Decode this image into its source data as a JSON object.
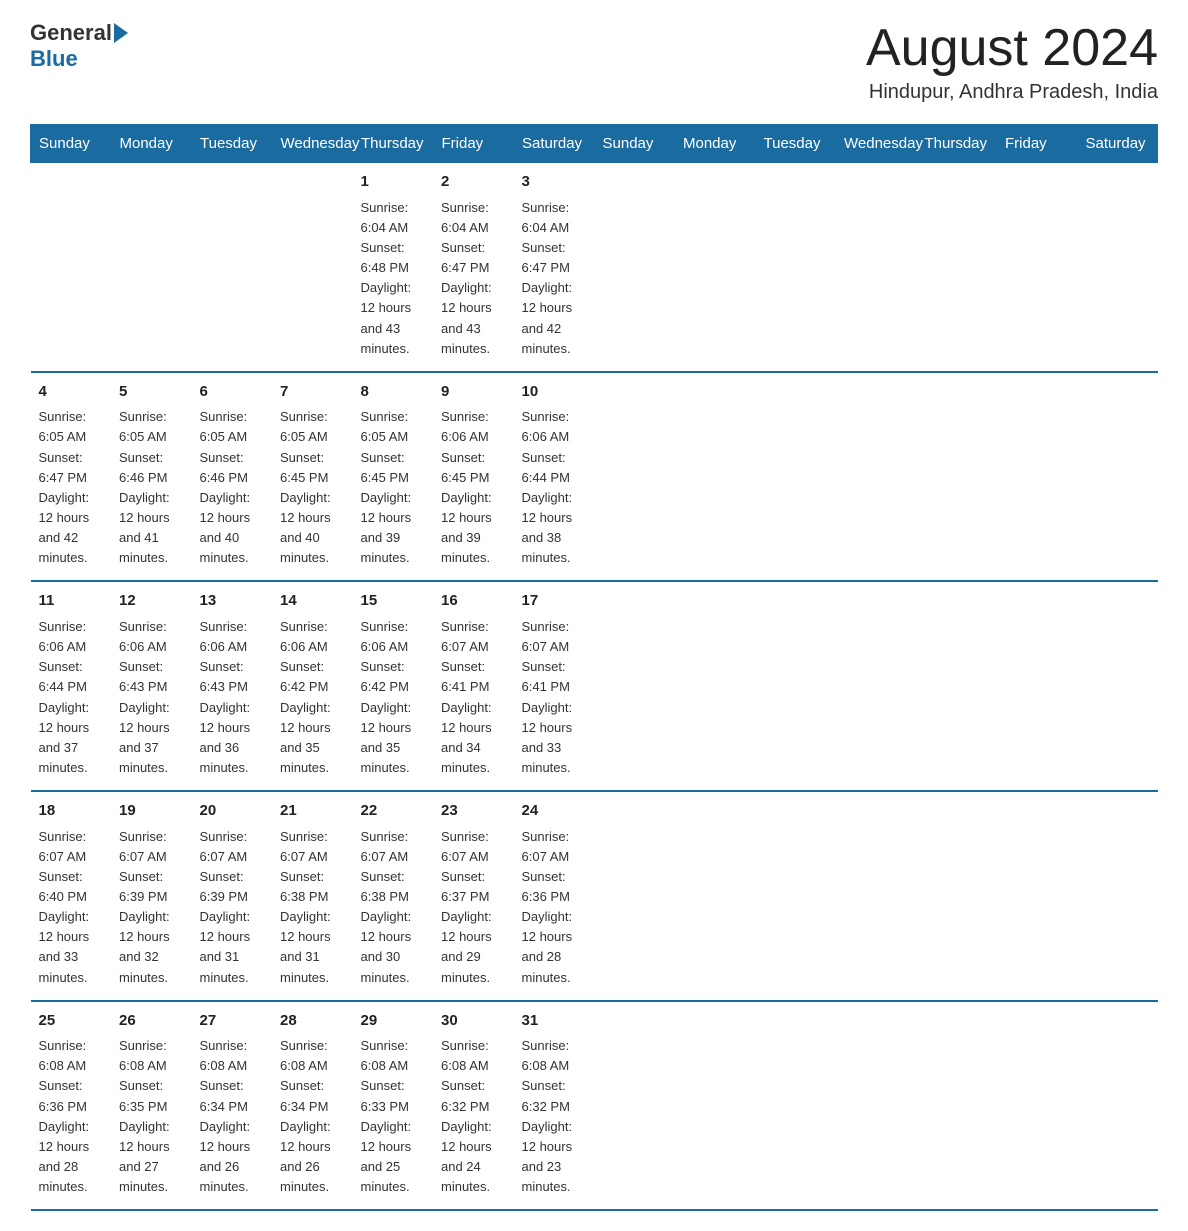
{
  "header": {
    "logo_general": "General",
    "logo_blue": "Blue",
    "title": "August 2024",
    "subtitle": "Hindupur, Andhra Pradesh, India"
  },
  "days_of_week": [
    "Sunday",
    "Monday",
    "Tuesday",
    "Wednesday",
    "Thursday",
    "Friday",
    "Saturday"
  ],
  "weeks": [
    [
      {
        "day": "",
        "info": ""
      },
      {
        "day": "",
        "info": ""
      },
      {
        "day": "",
        "info": ""
      },
      {
        "day": "",
        "info": ""
      },
      {
        "day": "1",
        "info": "Sunrise: 6:04 AM\nSunset: 6:48 PM\nDaylight: 12 hours\nand 43 minutes."
      },
      {
        "day": "2",
        "info": "Sunrise: 6:04 AM\nSunset: 6:47 PM\nDaylight: 12 hours\nand 43 minutes."
      },
      {
        "day": "3",
        "info": "Sunrise: 6:04 AM\nSunset: 6:47 PM\nDaylight: 12 hours\nand 42 minutes."
      }
    ],
    [
      {
        "day": "4",
        "info": "Sunrise: 6:05 AM\nSunset: 6:47 PM\nDaylight: 12 hours\nand 42 minutes."
      },
      {
        "day": "5",
        "info": "Sunrise: 6:05 AM\nSunset: 6:46 PM\nDaylight: 12 hours\nand 41 minutes."
      },
      {
        "day": "6",
        "info": "Sunrise: 6:05 AM\nSunset: 6:46 PM\nDaylight: 12 hours\nand 40 minutes."
      },
      {
        "day": "7",
        "info": "Sunrise: 6:05 AM\nSunset: 6:45 PM\nDaylight: 12 hours\nand 40 minutes."
      },
      {
        "day": "8",
        "info": "Sunrise: 6:05 AM\nSunset: 6:45 PM\nDaylight: 12 hours\nand 39 minutes."
      },
      {
        "day": "9",
        "info": "Sunrise: 6:06 AM\nSunset: 6:45 PM\nDaylight: 12 hours\nand 39 minutes."
      },
      {
        "day": "10",
        "info": "Sunrise: 6:06 AM\nSunset: 6:44 PM\nDaylight: 12 hours\nand 38 minutes."
      }
    ],
    [
      {
        "day": "11",
        "info": "Sunrise: 6:06 AM\nSunset: 6:44 PM\nDaylight: 12 hours\nand 37 minutes."
      },
      {
        "day": "12",
        "info": "Sunrise: 6:06 AM\nSunset: 6:43 PM\nDaylight: 12 hours\nand 37 minutes."
      },
      {
        "day": "13",
        "info": "Sunrise: 6:06 AM\nSunset: 6:43 PM\nDaylight: 12 hours\nand 36 minutes."
      },
      {
        "day": "14",
        "info": "Sunrise: 6:06 AM\nSunset: 6:42 PM\nDaylight: 12 hours\nand 35 minutes."
      },
      {
        "day": "15",
        "info": "Sunrise: 6:06 AM\nSunset: 6:42 PM\nDaylight: 12 hours\nand 35 minutes."
      },
      {
        "day": "16",
        "info": "Sunrise: 6:07 AM\nSunset: 6:41 PM\nDaylight: 12 hours\nand 34 minutes."
      },
      {
        "day": "17",
        "info": "Sunrise: 6:07 AM\nSunset: 6:41 PM\nDaylight: 12 hours\nand 33 minutes."
      }
    ],
    [
      {
        "day": "18",
        "info": "Sunrise: 6:07 AM\nSunset: 6:40 PM\nDaylight: 12 hours\nand 33 minutes."
      },
      {
        "day": "19",
        "info": "Sunrise: 6:07 AM\nSunset: 6:39 PM\nDaylight: 12 hours\nand 32 minutes."
      },
      {
        "day": "20",
        "info": "Sunrise: 6:07 AM\nSunset: 6:39 PM\nDaylight: 12 hours\nand 31 minutes."
      },
      {
        "day": "21",
        "info": "Sunrise: 6:07 AM\nSunset: 6:38 PM\nDaylight: 12 hours\nand 31 minutes."
      },
      {
        "day": "22",
        "info": "Sunrise: 6:07 AM\nSunset: 6:38 PM\nDaylight: 12 hours\nand 30 minutes."
      },
      {
        "day": "23",
        "info": "Sunrise: 6:07 AM\nSunset: 6:37 PM\nDaylight: 12 hours\nand 29 minutes."
      },
      {
        "day": "24",
        "info": "Sunrise: 6:07 AM\nSunset: 6:36 PM\nDaylight: 12 hours\nand 28 minutes."
      }
    ],
    [
      {
        "day": "25",
        "info": "Sunrise: 6:08 AM\nSunset: 6:36 PM\nDaylight: 12 hours\nand 28 minutes."
      },
      {
        "day": "26",
        "info": "Sunrise: 6:08 AM\nSunset: 6:35 PM\nDaylight: 12 hours\nand 27 minutes."
      },
      {
        "day": "27",
        "info": "Sunrise: 6:08 AM\nSunset: 6:34 PM\nDaylight: 12 hours\nand 26 minutes."
      },
      {
        "day": "28",
        "info": "Sunrise: 6:08 AM\nSunset: 6:34 PM\nDaylight: 12 hours\nand 26 minutes."
      },
      {
        "day": "29",
        "info": "Sunrise: 6:08 AM\nSunset: 6:33 PM\nDaylight: 12 hours\nand 25 minutes."
      },
      {
        "day": "30",
        "info": "Sunrise: 6:08 AM\nSunset: 6:32 PM\nDaylight: 12 hours\nand 24 minutes."
      },
      {
        "day": "31",
        "info": "Sunrise: 6:08 AM\nSunset: 6:32 PM\nDaylight: 12 hours\nand 23 minutes."
      }
    ]
  ]
}
